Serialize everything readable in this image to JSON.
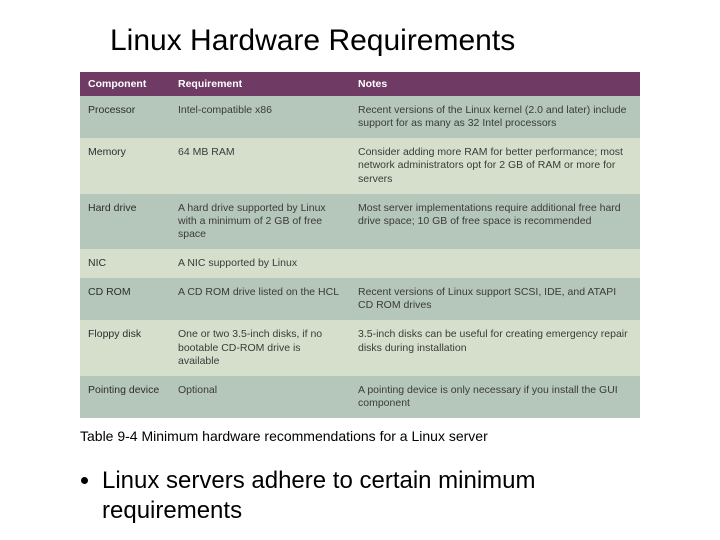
{
  "title": "Linux Hardware Requirements",
  "header": {
    "component": "Component",
    "requirement": "Requirement",
    "notes": "Notes"
  },
  "rows": {
    "r0": {
      "component": "Processor",
      "requirement": "Intel-compatible x86",
      "notes": "Recent versions of the Linux kernel (2.0 and later) include support for as many as 32 Intel processors"
    },
    "r1": {
      "component": "Memory",
      "requirement": "64 MB RAM",
      "notes": "Consider adding more RAM for better performance; most network administrators opt for 2 GB of RAM or more for servers"
    },
    "r2": {
      "component": "Hard drive",
      "requirement": "A hard drive supported by Linux with a minimum of 2 GB of free space",
      "notes": "Most server implementations require additional free hard drive space; 10 GB of free space is recommended"
    },
    "r3": {
      "component": "NIC",
      "requirement": "A NIC supported by Linux",
      "notes": ""
    },
    "r4": {
      "component": "CD ROM",
      "requirement": "A CD ROM drive listed on the HCL",
      "notes": "Recent versions of Linux support SCSI, IDE, and ATAPI CD ROM drives"
    },
    "r5": {
      "component": "Floppy disk",
      "requirement": "One or two 3.5-inch disks, if no bootable CD-ROM drive is available",
      "notes": "3.5-inch disks can be useful for creating emergency repair disks during installation"
    },
    "r6": {
      "component": "Pointing device",
      "requirement": "Optional",
      "notes": "A pointing device is only necessary if you install the GUI component"
    }
  },
  "caption": "Table 9-4 Minimum hardware recommendations for a Linux server",
  "bullet": "Linux servers adhere to certain minimum requirements",
  "chart_data": {
    "type": "table",
    "title": "Table 9-4 Minimum hardware recommendations for a Linux server",
    "columns": [
      "Component",
      "Requirement",
      "Notes"
    ],
    "rows": [
      [
        "Processor",
        "Intel-compatible x86",
        "Recent versions of the Linux kernel (2.0 and later) include support for as many as 32 Intel processors"
      ],
      [
        "Memory",
        "64 MB RAM",
        "Consider adding more RAM for better performance; most network administrators opt for 2 GB of RAM or more for servers"
      ],
      [
        "Hard drive",
        "A hard drive supported by Linux with a minimum of 2 GB of free space",
        "Most server implementations require additional free hard drive space; 10 GB of free space is recommended"
      ],
      [
        "NIC",
        "A NIC supported by Linux",
        ""
      ],
      [
        "CD ROM",
        "A CD ROM drive listed on the HCL",
        "Recent versions of Linux support SCSI, IDE, and ATAPI CD ROM drives"
      ],
      [
        "Floppy disk",
        "One or two 3.5-inch disks, if no bootable CD-ROM drive is available",
        "3.5-inch disks can be useful for creating emergency repair disks during installation"
      ],
      [
        "Pointing device",
        "Optional",
        "A pointing device is only necessary if you install the GUI component"
      ]
    ]
  }
}
